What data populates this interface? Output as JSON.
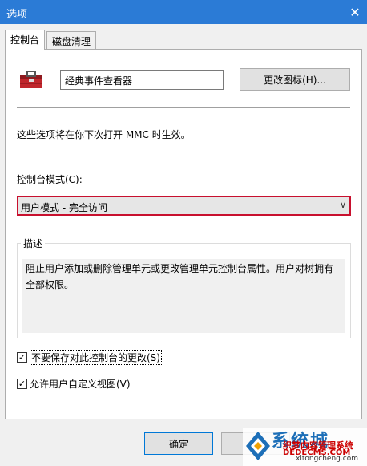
{
  "window": {
    "title": "选项"
  },
  "tabs": [
    {
      "label": "控制台",
      "active": true
    },
    {
      "label": "磁盘清理",
      "active": false
    }
  ],
  "console_name": "经典事件查看器",
  "change_icon_button": "更改图标(H)...",
  "info_text": "这些选项将在你下次打开 MMC 时生效。",
  "mode": {
    "label": "控制台模式(C):",
    "selected": "用户模式 - 完全访问"
  },
  "description": {
    "legend": "描述",
    "text": "阻止用户添加或删除管理单元或更改管理单元控制台属性。用户对树拥有全部权限。"
  },
  "checkboxes": [
    {
      "label": "不要保存对此控制台的更改(S)",
      "checked": true
    },
    {
      "label": "允许用户自定义视图(V)",
      "checked": true
    }
  ],
  "buttons": {
    "ok": "确定",
    "cancel": "取"
  },
  "watermark": {
    "brand": "系统城",
    "line1": "织梦内容管理系统",
    "line2": "DEDECMS.COM",
    "url": "xitongcheng.com"
  },
  "colors": {
    "titlebar": "#2b7bd6",
    "select_border": "#c8102e",
    "ok_border": "#0078d7"
  }
}
